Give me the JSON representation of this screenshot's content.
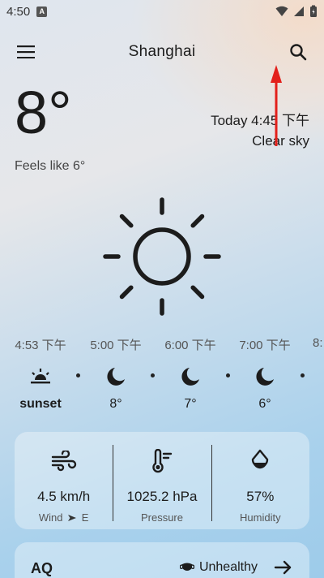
{
  "status_bar": {
    "time": "4:50",
    "notif_glyph": "A"
  },
  "app_bar": {
    "city": "Shanghai",
    "menu_icon": "hamburger-menu-icon",
    "search_icon": "search-icon"
  },
  "current": {
    "temperature": "8°",
    "feels_like": "Feels like 6°",
    "today": "Today 4:45 下午",
    "condition": "Clear sky",
    "condition_icon": "sun-icon"
  },
  "hourly": [
    {
      "time": "4:53 下午",
      "icon": "sunset-icon",
      "value": "sunset"
    },
    {
      "time": "5:00 下午",
      "icon": "moon-icon",
      "value": "8°"
    },
    {
      "time": "6:00 下午",
      "icon": "moon-icon",
      "value": "7°"
    },
    {
      "time": "7:00 下午",
      "icon": "moon-icon",
      "value": "6°"
    },
    {
      "time": "8:",
      "icon": "moon-icon",
      "value": ""
    }
  ],
  "metrics": {
    "wind": {
      "value": "4.5 km/h",
      "label": "Wind",
      "direction": "E",
      "icon": "wind-icon"
    },
    "pressure": {
      "value": "1025.2 hPa",
      "label": "Pressure",
      "icon": "thermometer-icon"
    },
    "humidity": {
      "value": "57%",
      "label": "Humidity",
      "icon": "water-drop-icon"
    }
  },
  "air_quality": {
    "title": "AQ",
    "status": "Unhealthy",
    "icon": "mask-icon",
    "arrow_icon": "arrow-right-icon"
  },
  "colors": {
    "annotation": "#e3201b",
    "icon": "#1c1c1c"
  }
}
